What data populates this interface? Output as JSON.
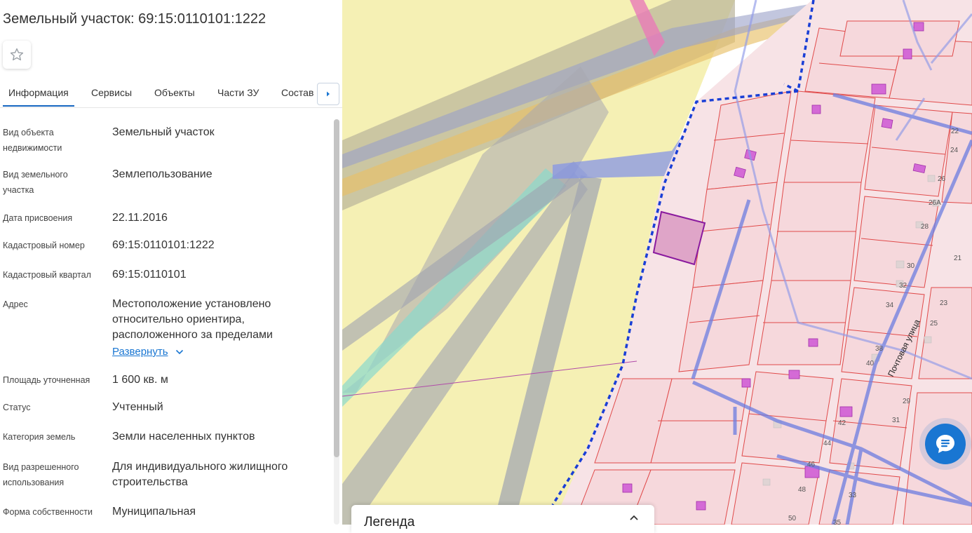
{
  "panel": {
    "title": "Земельный участок: 69:15:0110101:1222",
    "favorite_icon": "star-outline-icon",
    "tabs": [
      "Информация",
      "Сервисы",
      "Объекты",
      "Части ЗУ",
      "Состав"
    ],
    "tab_scroll_icon": "caret-right-icon",
    "properties": [
      {
        "label": "Вид объекта недвижимости",
        "value": "Земельный участок"
      },
      {
        "label": "Вид земельного участка",
        "value": "Землепользование"
      },
      {
        "label": "Дата присвоения",
        "value": "22.11.2016"
      },
      {
        "label": "Кадастровый номер",
        "value": "69:15:0110101:1222"
      },
      {
        "label": "Кадастровый квартал",
        "value": "69:15:0110101"
      },
      {
        "label": "Адрес",
        "value": "Местоположение установлено относительно ориентира, расположенного за пределами"
      },
      {
        "label": "Площадь уточненная",
        "value": "1 600 кв. м"
      },
      {
        "label": "Статус",
        "value": "Учтенный"
      },
      {
        "label": "Категория земель",
        "value": "Земли населенных пунктов"
      },
      {
        "label": "Вид разрешенного использования",
        "value": "Для индивидуального жилищного строительства"
      },
      {
        "label": "Форма собственности",
        "value": "Муниципальная"
      }
    ],
    "expand_label": "Развернуть",
    "expand_icon": "chevron-down-icon"
  },
  "map": {
    "street_label": "Почтовая улица",
    "house_numbers": [
      "22",
      "24",
      "26",
      "26А",
      "28",
      "30",
      "32",
      "34",
      "38",
      "40",
      "42",
      "44",
      "46",
      "48",
      "50",
      "35",
      "33",
      "31",
      "29",
      "25",
      "23",
      "21"
    ],
    "colors": {
      "zone_yellow": "#f5f0b4",
      "parcel_fill": "#f6d8dc",
      "parcel_stroke": "#e04a4a",
      "boundary_dashed": "#1a3fd6",
      "road_blue": "#7f8ee0",
      "highlight_parcel": "#8a1a9e"
    }
  },
  "legend": {
    "title": "Легенда",
    "toggle_icon": "chevron-up-icon"
  },
  "chat": {
    "icon": "chat-icon"
  }
}
